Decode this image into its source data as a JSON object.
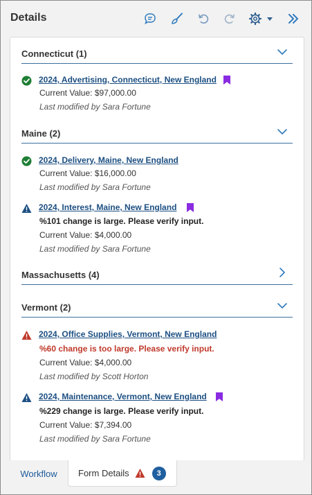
{
  "header": {
    "title": "Details",
    "icons": [
      "comment-icon",
      "brush-icon",
      "undo-icon",
      "redo-icon",
      "gear-icon",
      "caret-down-icon",
      "collapse-panel-icon"
    ]
  },
  "colors": {
    "accent": "#1f5f9f",
    "link": "#1c4f82",
    "success": "#1e7e34",
    "warning_icon": "#1c4f82",
    "error": "#c0392b",
    "bookmark": "#8a2be2"
  },
  "sections": [
    {
      "title": "Connecticut (1)",
      "expanded": true,
      "items": [
        {
          "status": "success",
          "link": "2024, Advertising, Connecticut, New England",
          "bookmarked": true,
          "message": "",
          "value": "Current Value: $97,000.00",
          "modified": "Last modified by Sara Fortune"
        }
      ]
    },
    {
      "title": "Maine (2)",
      "expanded": true,
      "items": [
        {
          "status": "success",
          "link": "2024, Delivery, Maine, New England",
          "bookmarked": false,
          "message": "",
          "value": "Current Value: $16,000.00",
          "modified": "Last modified by Sara Fortune"
        },
        {
          "status": "warning",
          "link": "2024, Interest, Maine, New England",
          "bookmarked": true,
          "message": "%101 change is large. Please verify input.",
          "value": "Current Value: $4,000.00",
          "modified": "Last modified by Sara Fortune"
        }
      ]
    },
    {
      "title": "Massachusetts (4)",
      "expanded": false,
      "items": []
    },
    {
      "title": "Vermont (2)",
      "expanded": true,
      "items": [
        {
          "status": "error",
          "link": "2024, Office Supplies, Vermont, New England",
          "bookmarked": false,
          "message": "%60 change is too large. Please verify input.",
          "value": "Current Value: $4,000.00",
          "modified": "Last modified by Scott Horton"
        },
        {
          "status": "warning",
          "link": "2024, Maintenance, Vermont, New England",
          "bookmarked": true,
          "message": "%229 change is large. Please verify input.",
          "value": "Current Value: $7,394.00",
          "modified": "Last modified by Sara Fortune"
        }
      ]
    }
  ],
  "tabs": {
    "workflow": "Workflow",
    "form_details": "Form Details",
    "badge_count": "3"
  }
}
